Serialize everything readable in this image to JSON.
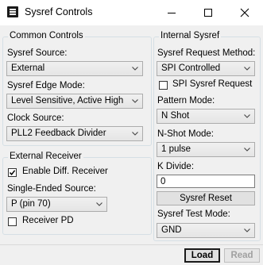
{
  "window": {
    "title": "Sysref Controls"
  },
  "common_controls": {
    "legend": "Common Controls",
    "sysref_source": {
      "label": "Sysref Source:",
      "value": "External"
    },
    "sysref_edge_mode": {
      "label": "Sysref Edge Mode:",
      "value": "Level Sensitive, Active High"
    },
    "clock_source": {
      "label": "Clock Source:",
      "value": "PLL2 Feedback Divider"
    }
  },
  "external_receiver": {
    "legend": "External Receiver",
    "enable_diff_receiver": {
      "label": "Enable Diff. Receiver",
      "checked": true
    },
    "single_ended_source": {
      "label": "Single-Ended Source:",
      "value": "P (pin 70)"
    },
    "receiver_pd": {
      "label": "Receiver PD",
      "checked": false
    }
  },
  "internal_sysref": {
    "legend": "Internal Sysref",
    "request_method": {
      "label": "Sysref Request Method:",
      "value": "SPI Controlled"
    },
    "spi_sysref_request": {
      "label": "SPI Sysref Request",
      "checked": false
    },
    "pattern_mode": {
      "label": "Pattern Mode:",
      "value": "N Shot"
    },
    "n_shot_mode": {
      "label": "N-Shot Mode:",
      "value": "1 pulse"
    },
    "k_divide": {
      "label": "K Divide:",
      "value": "0"
    },
    "sysref_reset_label": "Sysref Reset",
    "test_mode": {
      "label": "Sysref Test Mode:",
      "value": "GND"
    }
  },
  "footer": {
    "load_label": "Load",
    "read_label": "Read"
  },
  "colors": {
    "window_bg": "#f0f0f0",
    "group_border": "#d5dfe5",
    "combo_border": "#acacac",
    "disabled_text": "#a0a0a0"
  }
}
